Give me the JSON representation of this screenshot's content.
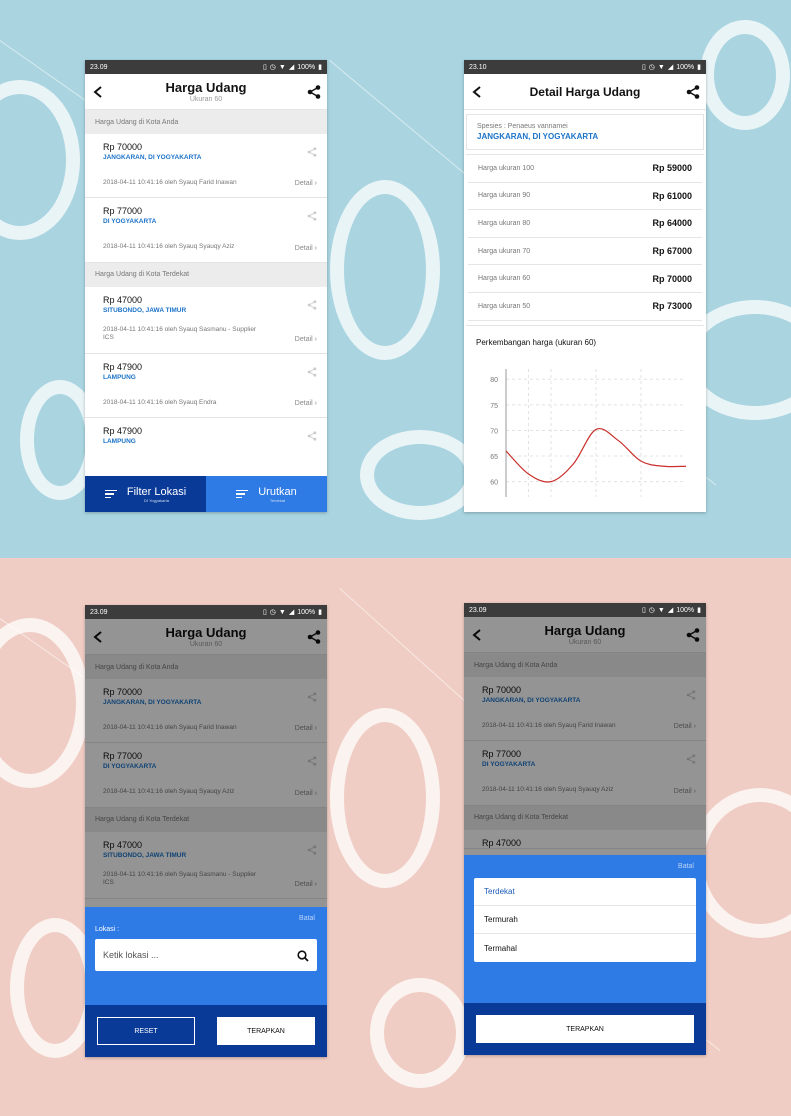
{
  "status": {
    "time_a": "23.09",
    "time_b": "23.10",
    "battery": "100%"
  },
  "list_screen": {
    "title": "Harga Udang",
    "subtitle": "Ukuran 60",
    "section_local": "Harga Udang di Kota Anda",
    "section_nearby": "Harga Udang di Kota Terdekat",
    "detail_label": "Detail",
    "items": [
      {
        "price": "Rp 70000",
        "location": "JANGKARAN, DI YOGYAKARTA",
        "meta": "2018-04-11 10:41:16 oleh Syauq Farid Inawan"
      },
      {
        "price": "Rp 77000",
        "location": "DI YOGYAKARTA",
        "meta": "2018-04-11 10:41:16 oleh Syauq Syauqy Aziz"
      },
      {
        "price": "Rp 47000",
        "location": "SITUBONDO, JAWA TIMUR",
        "meta": "2018-04-11 10:41:16 oleh Syauq Sasmanu - Supplier ICS"
      },
      {
        "price": "Rp 47900",
        "location": "LAMPUNG",
        "meta": "2018-04-11 10:41:16 oleh Syauq Endra"
      },
      {
        "price": "Rp 47900",
        "location": "LAMPUNG"
      }
    ],
    "nav": {
      "filter_label": "Filter Lokasi",
      "filter_sub": "DI Yogyakarta",
      "sort_label": "Urutkan",
      "sort_sub": "Terdekat"
    }
  },
  "detail_screen": {
    "title": "Detail Harga Udang",
    "species": "Spesies : Penaeus vannamei",
    "location": "JANGKARAN, DI YOGYAKARTA",
    "sizes": [
      {
        "label": "Harga ukuran 100",
        "price": "Rp 59000"
      },
      {
        "label": "Harga ukuran 90",
        "price": "Rp 61000"
      },
      {
        "label": "Harga ukuran 80",
        "price": "Rp 64000"
      },
      {
        "label": "Harga ukuran 70",
        "price": "Rp 67000"
      },
      {
        "label": "Harga ukuran 60",
        "price": "Rp 70000"
      },
      {
        "label": "Harga ukuran 50",
        "price": "Rp 73000"
      }
    ],
    "chart_title": "Perkembangan harga (ukuran 60)"
  },
  "chart_data": {
    "type": "line",
    "title": "Perkembangan harga (ukuran 60)",
    "xlabel": "",
    "ylabel": "",
    "yticks": [
      "80",
      "75",
      "70",
      "65",
      "60"
    ],
    "ylim": [
      57,
      82
    ],
    "x": [
      0,
      1,
      2,
      3,
      4,
      5,
      6,
      7,
      8
    ],
    "series": [
      {
        "values": [
          66,
          61.5,
          60,
          63.5,
          70.2,
          68,
          64,
          63,
          63
        ],
        "color": "#c9302c"
      }
    ],
    "grid": true
  },
  "filter_sheet": {
    "cancel": "Batal",
    "label": "Lokasi :",
    "placeholder": "Ketik lokasi ...",
    "reset": "RESET",
    "apply": "TERAPKAN"
  },
  "sort_sheet": {
    "cancel": "Batal",
    "options": [
      "Terdekat",
      "Termurah",
      "Termahal"
    ],
    "apply": "TERAPKAN"
  },
  "colors": {
    "primary_dark": "#0a3a98",
    "primary": "#2f7be6",
    "link": "#1b73c9",
    "line": "#c9302c"
  }
}
